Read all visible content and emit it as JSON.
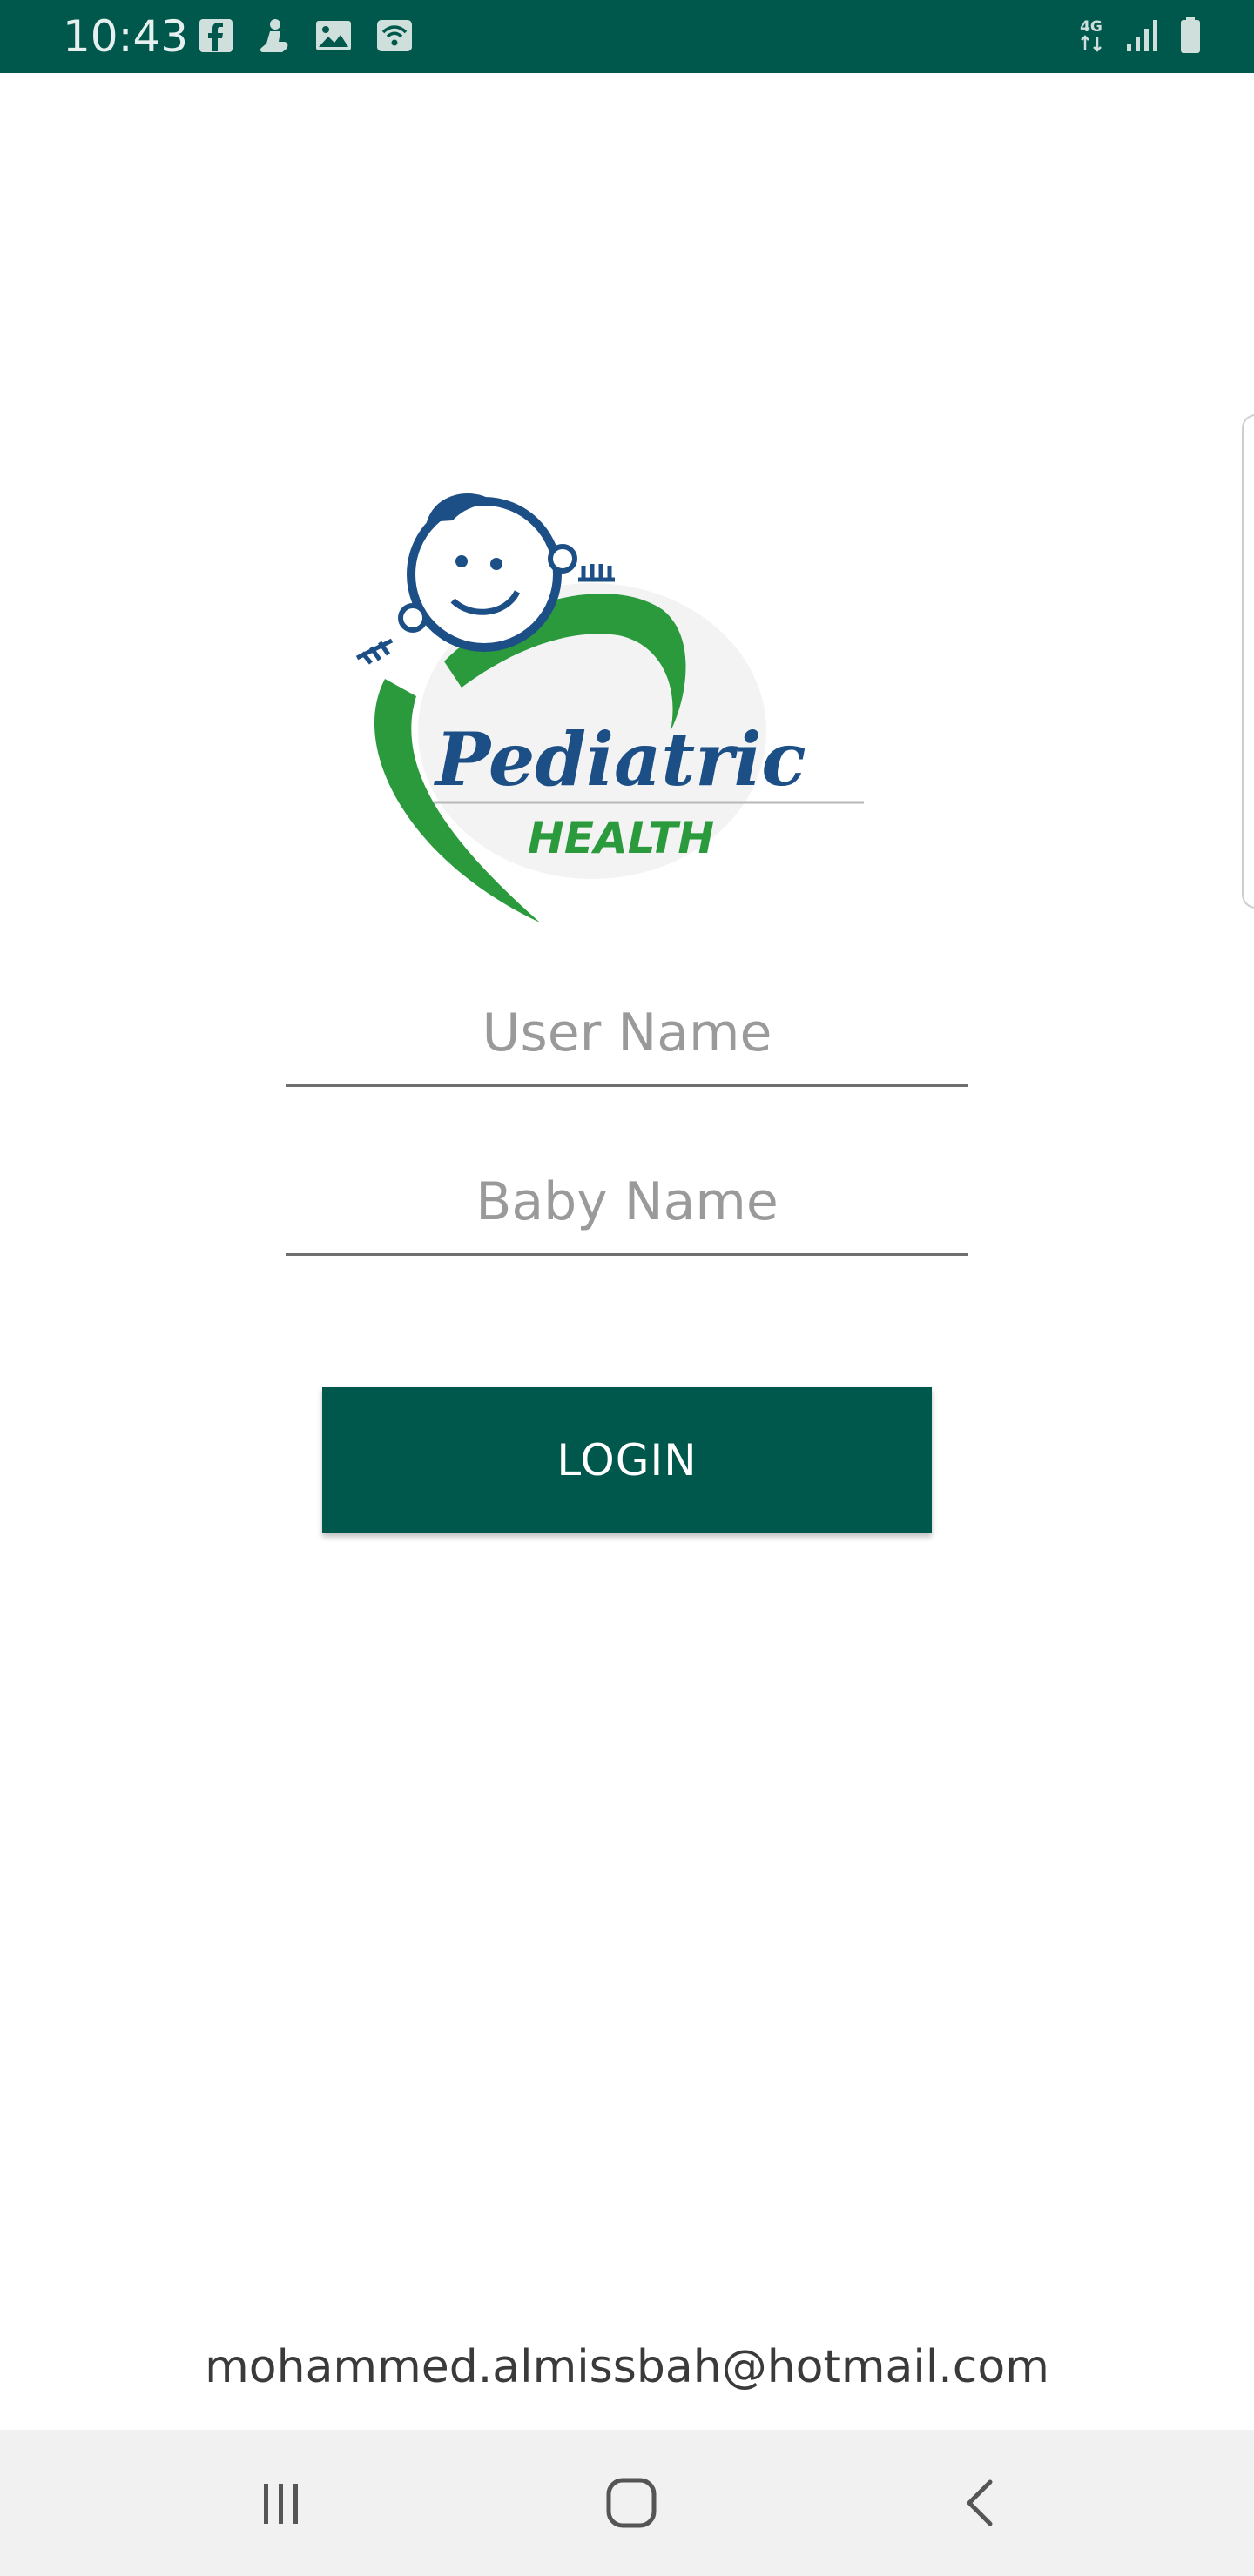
{
  "status_bar": {
    "time": "10:43",
    "network_label": "4G",
    "color": "#00574b",
    "left_icons": [
      "facebook-icon",
      "notification-figure-icon",
      "image-icon",
      "wifi-calling-icon"
    ],
    "right_icons": [
      "network-4g-icon",
      "signal-icon",
      "battery-icon"
    ]
  },
  "logo": {
    "title": "Pediatric",
    "subtitle": "HEALTH",
    "primary_color": "#1d4f87",
    "accent_color": "#2a9a3d"
  },
  "form": {
    "username_placeholder": "User Name",
    "username_value": "",
    "babyname_placeholder": "Baby Name",
    "babyname_value": "",
    "login_label": "LOGIN",
    "button_color": "#00574b"
  },
  "footer": {
    "email": "mohammed.almissbah@hotmail.com"
  },
  "nav_bar": {
    "buttons": [
      "recents-icon",
      "home-icon",
      "back-icon"
    ]
  }
}
